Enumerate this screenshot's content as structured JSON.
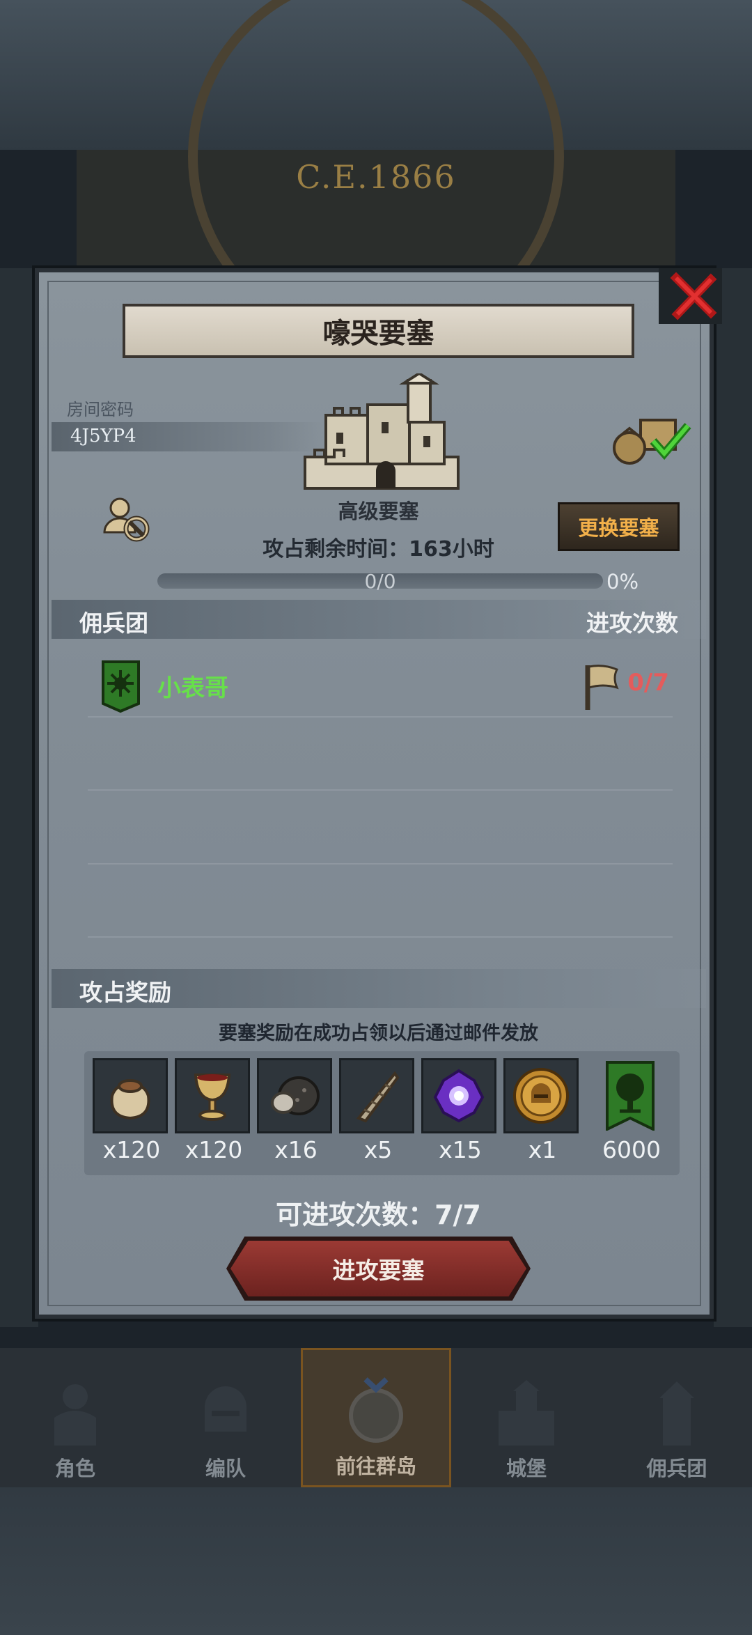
{
  "background": {
    "year_text": "C.E.1866"
  },
  "modal": {
    "title": "嚎哭要塞",
    "room_label": "房间密码",
    "room_code": "4J5YP4",
    "fortress_level": "高级要塞",
    "change_button": "更换要塞",
    "remaining_time": "攻占剩余时间：163小时",
    "progress": {
      "text": "0/0",
      "percent_label": "0%",
      "fraction": 0
    },
    "mercenary_header": "佣兵团",
    "attack_count_header": "进攻次数",
    "mercenaries": [
      {
        "name": "小表哥",
        "attack_count": "0/7"
      }
    ],
    "rewards_header": "攻占奖励",
    "reward_note": "要塞奖励在成功占领以后通过邮件发放",
    "rewards": [
      {
        "icon": "pouch-icon",
        "qty": "x120"
      },
      {
        "icon": "chalice-icon",
        "qty": "x120"
      },
      {
        "icon": "ore-icon",
        "qty": "x16"
      },
      {
        "icon": "horn-icon",
        "qty": "x5"
      },
      {
        "icon": "purple-gem-icon",
        "qty": "x15"
      },
      {
        "icon": "helmet-coin-icon",
        "qty": "x1"
      },
      {
        "icon": "tree-banner-icon",
        "qty": "6000"
      }
    ],
    "attack_times": "可进攻次数：7/7",
    "attack_button": "进攻要塞"
  },
  "nav": [
    {
      "label": "角色"
    },
    {
      "label": "编队"
    },
    {
      "label": "前往群岛"
    },
    {
      "label": "城堡"
    },
    {
      "label": "佣兵团"
    }
  ]
}
